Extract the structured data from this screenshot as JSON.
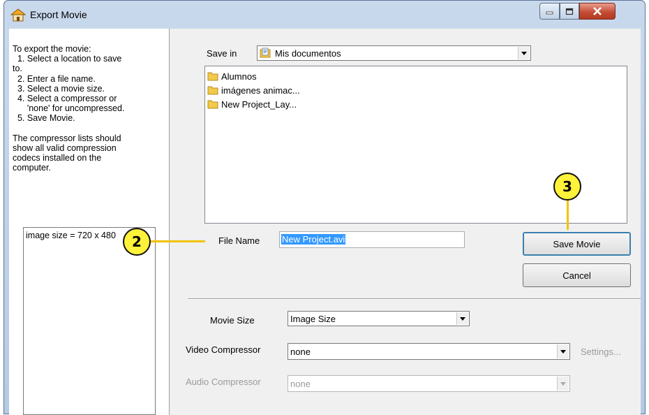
{
  "window": {
    "title": "Export Movie"
  },
  "instructions": {
    "text": "To export the movie:\n  1. Select a location to save\nto.\n  2. Enter a file name.\n  3. Select a movie size.\n  4. Select a compressor or\n      'none' for uncompressed.\n  5. Save Movie.\n\nThe compressor lists should\nshow all valid compression\ncodecs installed on the\ncomputer."
  },
  "info_box": {
    "text": "image size = 720 x 480"
  },
  "save_in": {
    "label": "Save in",
    "value": "Mis documentos"
  },
  "files": [
    {
      "name": "Alumnos",
      "icon": "folder-icon"
    },
    {
      "name": "imágenes animac...",
      "icon": "folder-icon"
    },
    {
      "name": "New Project_Lay...",
      "icon": "folder-icon"
    }
  ],
  "file_name": {
    "label": "File Name",
    "value": "New Project.avi"
  },
  "buttons": {
    "save": "Save Movie",
    "cancel": "Cancel",
    "settings": "Settings..."
  },
  "movie_size": {
    "label": "Movie Size",
    "value": "Image Size"
  },
  "video_compressor": {
    "label": "Video Compressor",
    "value": "none"
  },
  "audio_compressor": {
    "label": "Audio Compressor",
    "value": "none"
  },
  "callouts": {
    "two": "2",
    "three": "3"
  },
  "colors": {
    "callout_fill": "#fff23a",
    "callout_line": "#f2c200",
    "selection": "#3399ff"
  }
}
